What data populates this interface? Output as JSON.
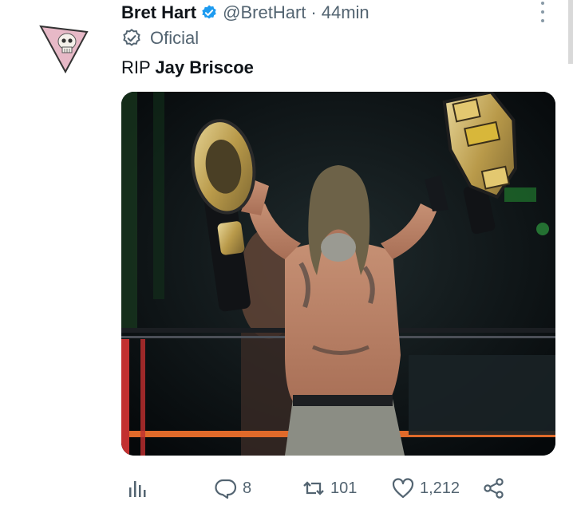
{
  "tweet": {
    "author_name": "Bret Hart",
    "handle": "@BretHart",
    "separator": "·",
    "timestamp": "44min",
    "badge_label": "Oficial",
    "text_prefix": "RIP ",
    "text_bold": "Jay Briscoe"
  },
  "actions": {
    "replies": "8",
    "retweets": "101",
    "likes": "1,212"
  },
  "colors": {
    "verified": "#1d9bf0",
    "muted": "#536471",
    "text": "#0f1419"
  },
  "icons": [
    "analytics-icon",
    "reply-icon",
    "retweet-icon",
    "like-icon",
    "share-icon",
    "verified-icon",
    "official-badge-icon",
    "more-icon"
  ]
}
